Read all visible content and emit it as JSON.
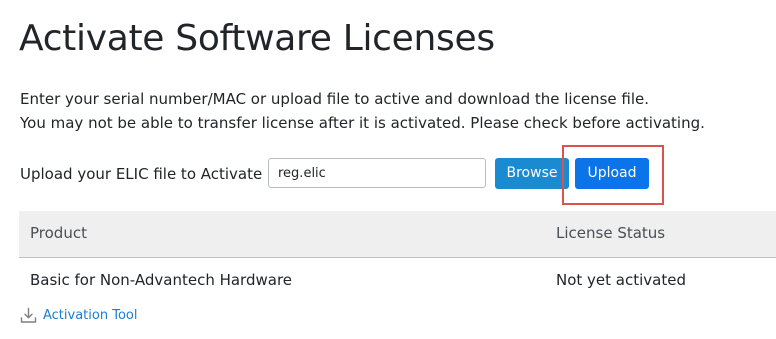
{
  "page": {
    "title": "Activate Software Licenses"
  },
  "intro": {
    "line1": "Enter your serial number/MAC or upload file to active and download the license file.",
    "line2": "You may not be able to transfer license after it is activated. Please check before activating."
  },
  "upload": {
    "label": "Upload your ELIC file to Activate",
    "file_value": "reg.elic",
    "browse_label": "Browse",
    "upload_label": "Upload"
  },
  "table": {
    "headers": {
      "product": "Product",
      "status": "License Status"
    },
    "rows": [
      {
        "product": "Basic for Non-Advantech Hardware",
        "status": "Not yet activated"
      }
    ]
  },
  "links": {
    "activation_tool": "Activation Tool",
    "activation_tool_icon": "download-icon"
  },
  "colors": {
    "browse_button": "#1a8bd1",
    "upload_button": "#0a74e8",
    "highlight": "#d9534f",
    "link": "#1a7fd1"
  }
}
